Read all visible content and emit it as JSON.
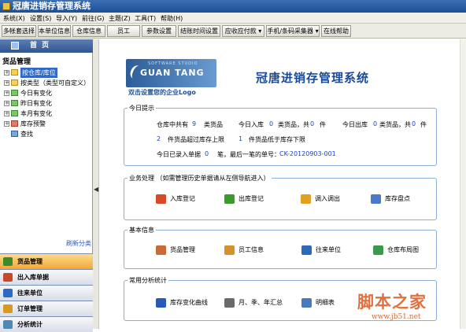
{
  "window": {
    "title": "冠唐进销存管理系统"
  },
  "menu": [
    "系统(X)",
    "设置(S)",
    "导入(Y)",
    "前往(G)",
    "主题(Z)",
    "工具(T)",
    "帮助(H)"
  ],
  "toolbar": [
    "多帐套选择",
    "本单位信息",
    "仓库信息",
    "员工",
    "参数设置",
    "结账时间设置",
    "应收应付款 ▾",
    "手机/条码采集器 ▾",
    "在线帮助"
  ],
  "sidebar": {
    "header": "首页",
    "root": "货品管理",
    "items": [
      {
        "label": "按仓库/库位",
        "selected": true
      },
      {
        "label": "按类型（类型可自定义）"
      },
      {
        "label": "今日有变化"
      },
      {
        "label": "昨日有变化"
      },
      {
        "label": "本月有变化"
      },
      {
        "label": "库存预警"
      },
      {
        "label": "查找"
      }
    ],
    "refresh": "刷新分类",
    "tabs": [
      "货品管理",
      "出入库单据",
      "往来单位",
      "订单管理",
      "分析统计"
    ]
  },
  "brand": {
    "logo_top": "SOFTWARE STUDIO",
    "logo_main": "GUAN TANG",
    "logo_sub": "双击设置您的企业Logo",
    "system_title": "冠唐进销存管理系统"
  },
  "today": {
    "title": "今日提示",
    "r1a": "仓库中共有",
    "r1a_n": "9",
    "r1a_u": "类货品",
    "r1b": "今日入库",
    "r1b_n": "0",
    "r1b_u": "类货品，共",
    "r1b_n2": "0",
    "r1b_u2": "件",
    "r1c": "今日出库",
    "r1c_n": "0",
    "r1c_u": "类货品，共",
    "r1c_n2": "0",
    "r1c_u2": "件",
    "r2a_n": "2",
    "r2a": "件货品超过库存上限",
    "r2b_n": "1",
    "r2b": "件货品低于库存下限",
    "r3a": "今日已录入单据",
    "r3a_n": "0",
    "r3a_u": "笔，最后一笔的单号：",
    "r3_no": "CK-20120903-001"
  },
  "business": {
    "title": "业务处理 （如需管理历史单据请从左侧导航进入）",
    "buttons": [
      "入库登记",
      "出库登记",
      "调入调出",
      "库存盘点"
    ]
  },
  "basic": {
    "title": "基本信息",
    "buttons": [
      "货品管理",
      "员工信息",
      "往来单位",
      "仓库布局图"
    ]
  },
  "stats": {
    "title": "常用分析统计",
    "buttons": [
      "库存变化曲线",
      "月、季、年汇总",
      "明细表"
    ]
  },
  "watermark": {
    "main": "脚本之家",
    "url": "www.jb51.net"
  },
  "colors": {
    "accent": "#1a4a98",
    "number": "#1a3fd4",
    "selection": "#316ac5"
  }
}
